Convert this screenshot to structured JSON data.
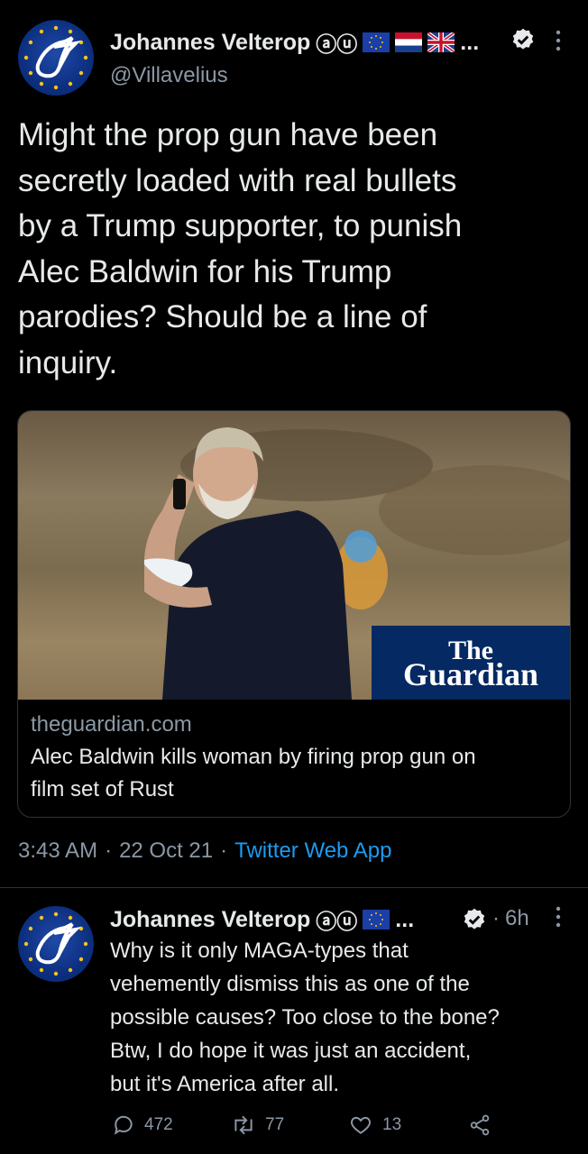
{
  "main_tweet": {
    "author_name": "Johannes Velterop",
    "author_badges": "ⓐⓤ",
    "overflow_indicator": "...",
    "handle": "@Villavelius",
    "text_lines": [
      "Might the prop gun have been",
      "secretly loaded with real bullets",
      "by a Trump supporter, to punish",
      "Alec Baldwin for his Trump",
      "parodies? Should be a line of",
      "inquiry."
    ],
    "card": {
      "logo_line1": "The",
      "logo_line2": "Guardian",
      "domain": "theguardian.com",
      "title_line1": "Alec Baldwin kills woman by firing prop gun on",
      "title_line2": "film set of Rust"
    },
    "time": "3:43 AM",
    "sep1": "·",
    "date": "22 Oct 21",
    "sep2": "·",
    "source": "Twitter Web App"
  },
  "reply": {
    "author_name": "Johannes Velterop",
    "author_badges": "ⓐⓤ",
    "overflow_indicator": "...",
    "age_sep": "·",
    "age": "6h",
    "text_lines": [
      "Why is it only MAGA-types that",
      "vehemently dismiss this as one of the",
      "possible causes? Too close to the bone?",
      "Btw, I do hope it was just an accident,",
      "but it's America after all."
    ],
    "reply_count": "472",
    "retweet_count": "77",
    "like_count": "13"
  },
  "colors": {
    "background": "#000000",
    "accent": "#1d9bf0",
    "secondary_text": "#8b98a5",
    "guardian_blue": "#052962"
  },
  "icons": [
    "avatar-logo",
    "eu-flag-icon",
    "nl-flag-icon",
    "uk-flag-icon",
    "verified-icon",
    "more-icon",
    "reply-icon",
    "retweet-icon",
    "like-icon",
    "share-icon"
  ]
}
